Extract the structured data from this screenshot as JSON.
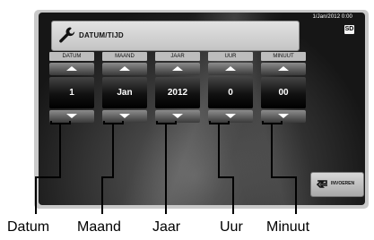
{
  "header": {
    "title": "DATUM/TIJD",
    "datetime": "1/Jan/2012 0:00",
    "sd_badge": "SD"
  },
  "columns": [
    {
      "label": "DATUM",
      "value": "1"
    },
    {
      "label": "MAAND",
      "value": "Jan"
    },
    {
      "label": "JAAR",
      "value": "2012"
    },
    {
      "label": "UUR",
      "value": "0"
    },
    {
      "label": "MINUUT",
      "value": "00"
    }
  ],
  "enter_button": {
    "label": "INVOEREN"
  },
  "callout_labels": [
    "Datum",
    "Maand",
    "Jaar",
    "Uur",
    "Minuut"
  ],
  "icons": {
    "title": "wrench-icon",
    "enter": "enter-icon",
    "increment": "arrow-up-icon",
    "decrement": "arrow-down-icon"
  },
  "colors": {
    "screen": "#111111",
    "title_bar": "#d2d2d2",
    "value_box": "#000000",
    "text_on_dark": "#ffffff"
  }
}
